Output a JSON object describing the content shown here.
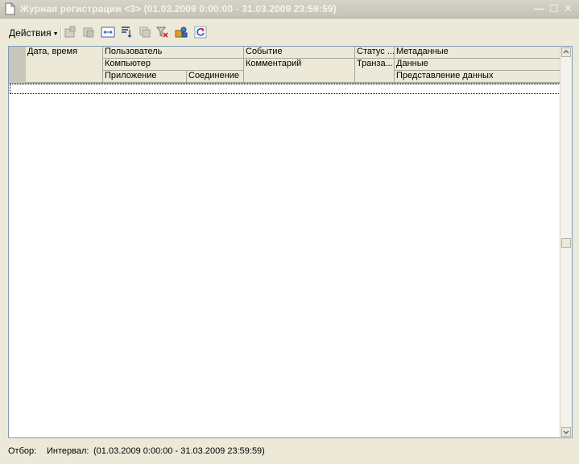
{
  "window": {
    "title": "Журная регистрации <3> (01.03.2009 0:00:00 - 31.03.2009 23:59:59)",
    "minimize": "—",
    "maximize": "☐",
    "close": "✕"
  },
  "toolbar": {
    "actions_label": "Действия",
    "icons": [
      "open-icon",
      "copy-icon",
      "column-width-icon",
      "sort-icon",
      "group-icon",
      "filter-clear-icon",
      "user-edit-icon",
      "refresh-icon"
    ]
  },
  "table": {
    "headers": {
      "datetime": "Дата, время",
      "user": "Пользователь",
      "computer": "Компьютер",
      "application": "Приложение",
      "connection": "Соединение",
      "event": "Событие",
      "comment": "Комментарий",
      "status": "Статус ...",
      "transaction": "Транза...",
      "metadata": "Метаданные",
      "data": "Данные",
      "data_presentation": "Представление данных"
    },
    "rows": []
  },
  "status": {
    "filter_label": "Отбор:",
    "interval_label": "Интервал:",
    "interval_value": "(01.03.2009 0:00:00 - 31.03.2009 23:59:59)"
  },
  "colors": {
    "window_bg": "#ece9d8",
    "grid_border": "#7f9db9",
    "title_text": "#f4f3ee"
  }
}
